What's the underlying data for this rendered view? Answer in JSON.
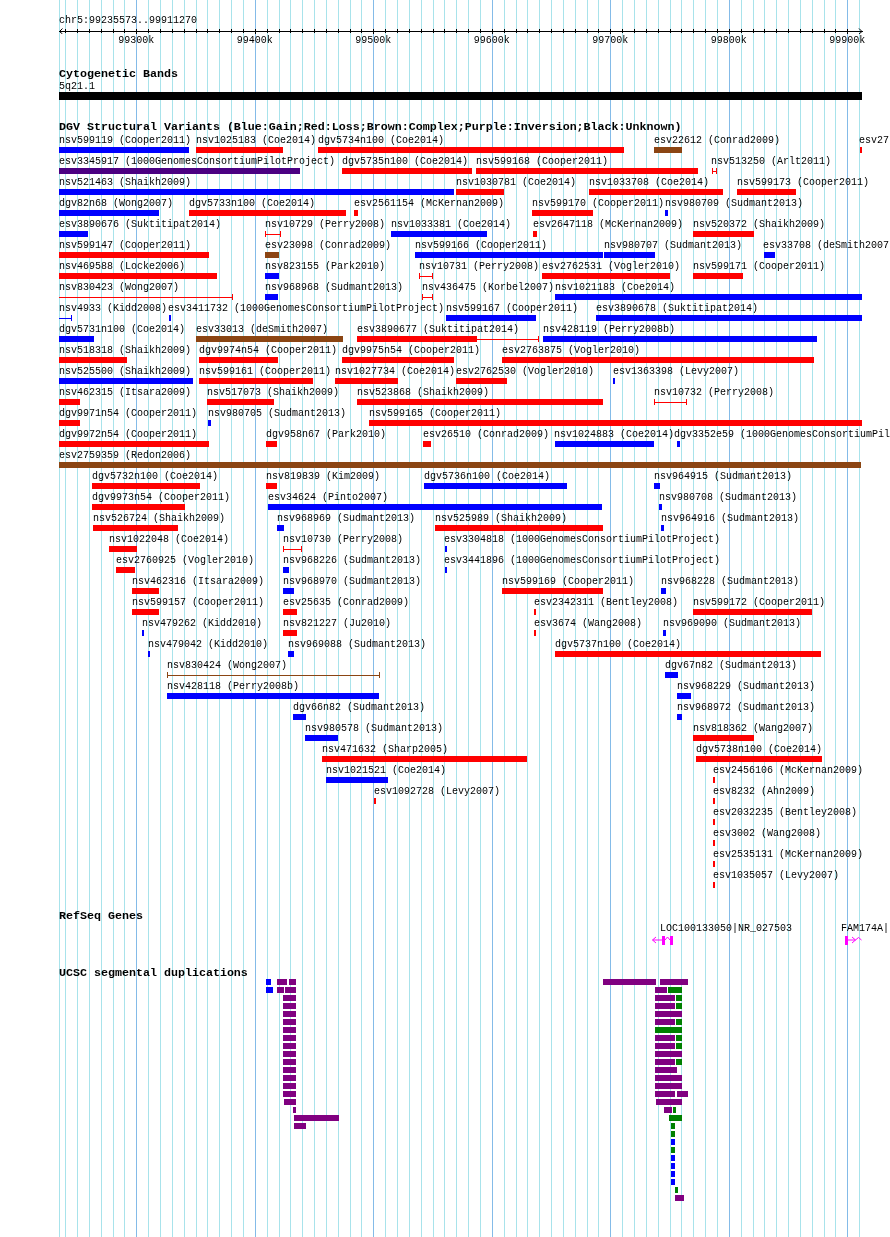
{
  "ruler": {
    "title": "chr5:99235573..99911270",
    "ticks": [
      "99300k",
      "99400k",
      "99500k",
      "99600k",
      "99700k",
      "99800k",
      "99900k"
    ]
  },
  "cytogenetic_bands": {
    "title": "Cytogenetic Bands",
    "bands": [
      {
        "label": "5q21.1"
      }
    ]
  },
  "dgv_variants": {
    "title": "DGV Structural Variants (Blue:Gain;Red:Loss;Brown:Complex;Purple:Inversion;Black:Unknown)",
    "features": [
      {
        "label": "nsv599119 (Cooper2011)",
        "color": "#0000ff",
        "kind": "bar"
      },
      {
        "label": "nsv1025183 (Coe2014)",
        "color": "#ff0000",
        "kind": "bar"
      },
      {
        "label": "dgv5734n100 (Coe2014)",
        "color": "#ff0000",
        "kind": "bar"
      },
      {
        "label": "esv22612 (Conrad2009)",
        "color": "#8b4513",
        "kind": "bar"
      },
      {
        "label": "esv27",
        "color": "#ff0000",
        "kind": "bar"
      },
      {
        "label": "esv3345917 (1000GenomesConsortiumPilotProject)",
        "color": "#4b0082",
        "kind": "bar"
      },
      {
        "label": "dgv5735n100 (Coe2014)",
        "color": "#ff0000",
        "kind": "bar"
      },
      {
        "label": "nsv599168 (Cooper2011)",
        "color": "#ff0000",
        "kind": "bar"
      },
      {
        "label": "nsv513250 (Arlt2011)",
        "color": "#ff0000",
        "kind": "interval"
      },
      {
        "label": "nsv521463 (Shaikh2009)",
        "color": "#0000ff",
        "kind": "bar"
      },
      {
        "label": "nsv1030781 (Coe2014)",
        "color": "#ff0000",
        "kind": "bar"
      },
      {
        "label": "nsv1033708 (Coe2014)",
        "color": "#ff0000",
        "kind": "bar"
      },
      {
        "label": "nsv599173 (Cooper2011)",
        "color": "#ff0000",
        "kind": "bar"
      },
      {
        "label": "dgv82n68 (Wong2007)",
        "color": "#0000ff",
        "kind": "bar"
      },
      {
        "label": "dgv5733n100 (Coe2014)",
        "color": "#ff0000",
        "kind": "bar"
      },
      {
        "label": "esv2561154 (McKernan2009)",
        "color": "#ff0000",
        "kind": "bar"
      },
      {
        "label": "nsv599170 (Cooper2011)",
        "color": "#ff0000",
        "kind": "bar"
      },
      {
        "label": "nsv980709 (Sudmant2013)",
        "color": "#0000ff",
        "kind": "bar"
      },
      {
        "label": "esv3890676 (Suktitipat2014)",
        "color": "#0000ff",
        "kind": "bar"
      },
      {
        "label": "nsv10729 (Perry2008)",
        "color": "#ff0000",
        "kind": "interval"
      },
      {
        "label": "nsv1033381 (Coe2014)",
        "color": "#0000ff",
        "kind": "bar"
      },
      {
        "label": "esv2647118 (McKernan2009)",
        "color": "#ff0000",
        "kind": "bar"
      },
      {
        "label": "nsv520372 (Shaikh2009)",
        "color": "#ff0000",
        "kind": "bar"
      },
      {
        "label": "nsv599147 (Cooper2011)",
        "color": "#ff0000",
        "kind": "bar"
      },
      {
        "label": "esv23098 (Conrad2009)",
        "color": "#8b4513",
        "kind": "bar"
      },
      {
        "label": "nsv599166 (Cooper2011)",
        "color": "#0000ff",
        "kind": "bar"
      },
      {
        "label": "nsv980707 (Sudmant2013)",
        "color": "#0000ff",
        "kind": "bar"
      },
      {
        "label": "esv33708 (deSmith2007",
        "color": "#0000ff",
        "kind": "bar"
      },
      {
        "label": "nsv469588 (Locke2006)",
        "color": "#ff0000",
        "kind": "bar"
      },
      {
        "label": "nsv823155 (Park2010)",
        "color": "#0000ff",
        "kind": "bar"
      },
      {
        "label": "nsv10731 (Perry2008)",
        "color": "#ff0000",
        "kind": "interval"
      },
      {
        "label": "esv2762531 (Vogler2010)",
        "color": "#ff0000",
        "kind": "bar"
      },
      {
        "label": "nsv599171 (Cooper2011)",
        "color": "#ff0000",
        "kind": "bar"
      },
      {
        "label": "nsv830423 (Wong2007)",
        "color": "#ff0000",
        "kind": "interval"
      },
      {
        "label": "nsv968968 (Sudmant2013)",
        "color": "#0000ff",
        "kind": "bar"
      },
      {
        "label": "nsv436475 (Korbel2007)",
        "color": "#ff0000",
        "kind": "interval"
      },
      {
        "label": "nsv1021183 (Coe2014)",
        "color": "#0000ff",
        "kind": "bar"
      },
      {
        "label": "nsv4933 (Kidd2008)",
        "color": "#0000ff",
        "kind": "interval"
      },
      {
        "label": "esv3411732 (1000GenomesConsortiumPilotProject)",
        "color": "#0000ff",
        "kind": "bar"
      },
      {
        "label": "nsv599167 (Cooper2011)",
        "color": "#0000ff",
        "kind": "bar"
      },
      {
        "label": "esv3890678 (Suktitipat2014)",
        "color": "#0000ff",
        "kind": "bar"
      },
      {
        "label": "dgv5731n100 (Coe2014)",
        "color": "#0000ff",
        "kind": "bar"
      },
      {
        "label": "esv33013 (deSmith2007)",
        "color": "#8b4513",
        "kind": "bar"
      },
      {
        "label": "esv3890677 (Suktitipat2014)",
        "color": "#ff0000",
        "kind": "bar_interval"
      },
      {
        "label": "nsv428119 (Perry2008b)",
        "color": "#0000ff",
        "kind": "bar"
      },
      {
        "label": "nsv518318 (Shaikh2009)",
        "color": "#ff0000",
        "kind": "bar"
      },
      {
        "label": "dgv9974n54 (Cooper2011)",
        "color": "#ff0000",
        "kind": "bar"
      },
      {
        "label": "dgv9975n54 (Cooper2011)",
        "color": "#ff0000",
        "kind": "bar"
      },
      {
        "label": "esv2763875 (Vogler2010)",
        "color": "#ff0000",
        "kind": "bar"
      },
      {
        "label": "nsv525500 (Shaikh2009)",
        "color": "#0000ff",
        "kind": "bar"
      },
      {
        "label": "nsv599161 (Cooper2011)",
        "color": "#ff0000",
        "kind": "bar"
      },
      {
        "label": "nsv1027734 (Coe2014)",
        "color": "#ff0000",
        "kind": "bar"
      },
      {
        "label": "esv2762530 (Vogler2010)",
        "color": "#ff0000",
        "kind": "bar"
      },
      {
        "label": "esv1363398 (Levy2007)",
        "color": "#0000ff",
        "kind": "bar"
      },
      {
        "label": "nsv462315 (Itsara2009)",
        "color": "#ff0000",
        "kind": "bar"
      },
      {
        "label": "nsv517073 (Shaikh2009)",
        "color": "#ff0000",
        "kind": "bar"
      },
      {
        "label": "nsv523868 (Shaikh2009)",
        "color": "#ff0000",
        "kind": "bar"
      },
      {
        "label": "nsv10732 (Perry2008)",
        "color": "#ff0000",
        "kind": "interval"
      },
      {
        "label": "dgv9971n54 (Cooper2011)",
        "color": "#ff0000",
        "kind": "bar"
      },
      {
        "label": "nsv980705 (Sudmant2013)",
        "color": "#0000ff",
        "kind": "bar"
      },
      {
        "label": "nsv599165 (Cooper2011)",
        "color": "#ff0000",
        "kind": "bar"
      },
      {
        "label": "dgv9972n54 (Cooper2011)",
        "color": "#ff0000",
        "kind": "bar"
      },
      {
        "label": "dgv958n67 (Park2010)",
        "color": "#ff0000",
        "kind": "bar"
      },
      {
        "label": "esv26510 (Conrad2009)",
        "color": "#ff0000",
        "kind": "bar"
      },
      {
        "label": "nsv1024883 (Coe2014)",
        "color": "#0000ff",
        "kind": "bar"
      },
      {
        "label": "dgv3352e59 (1000GenomesConsortiumPil",
        "color": "#0000ff",
        "kind": "bar"
      },
      {
        "label": "esv2759359 (Redon2006)",
        "color": "#8b4513",
        "kind": "bar"
      },
      {
        "label": "dgv5732n100 (Coe2014)",
        "color": "#ff0000",
        "kind": "bar"
      },
      {
        "label": "nsv819839 (Kim2009)",
        "color": "#ff0000",
        "kind": "bar"
      },
      {
        "label": "dgv5736n100 (Coe2014)",
        "color": "#0000ff",
        "kind": "bar"
      },
      {
        "label": "nsv964915 (Sudmant2013)",
        "color": "#0000ff",
        "kind": "bar"
      },
      {
        "label": "dgv9973n54 (Cooper2011)",
        "color": "#ff0000",
        "kind": "bar"
      },
      {
        "label": "esv34624 (Pinto2007)",
        "color": "#0000ff",
        "kind": "bar"
      },
      {
        "label": "nsv980708 (Sudmant2013)",
        "color": "#0000ff",
        "kind": "bar"
      },
      {
        "label": "nsv526724 (Shaikh2009)",
        "color": "#ff0000",
        "kind": "bar"
      },
      {
        "label": "nsv968969 (Sudmant2013)",
        "color": "#0000ff",
        "kind": "bar"
      },
      {
        "label": "nsv525989 (Shaikh2009)",
        "color": "#ff0000",
        "kind": "bar"
      },
      {
        "label": "nsv964916 (Sudmant2013)",
        "color": "#0000ff",
        "kind": "bar"
      },
      {
        "label": "nsv1022048 (Coe2014)",
        "color": "#ff0000",
        "kind": "bar"
      },
      {
        "label": "nsv10730 (Perry2008)",
        "color": "#ff0000",
        "kind": "interval"
      },
      {
        "label": "esv3304818 (1000GenomesConsortiumPilotProject)",
        "color": "#0000ff",
        "kind": "bar"
      },
      {
        "label": "esv2760925 (Vogler2010)",
        "color": "#ff0000",
        "kind": "bar"
      },
      {
        "label": "nsv968226 (Sudmant2013)",
        "color": "#0000ff",
        "kind": "bar"
      },
      {
        "label": "esv3441896 (1000GenomesConsortiumPilotProject)",
        "color": "#0000ff",
        "kind": "bar"
      },
      {
        "label": "nsv462316 (Itsara2009)",
        "color": "#ff0000",
        "kind": "bar"
      },
      {
        "label": "nsv968970 (Sudmant2013)",
        "color": "#0000ff",
        "kind": "bar"
      },
      {
        "label": "nsv599169 (Cooper2011)",
        "color": "#ff0000",
        "kind": "bar"
      },
      {
        "label": "nsv968228 (Sudmant2013)",
        "color": "#0000ff",
        "kind": "bar"
      },
      {
        "label": "nsv599157 (Cooper2011)",
        "color": "#ff0000",
        "kind": "bar"
      },
      {
        "label": "esv25635 (Conrad2009)",
        "color": "#ff0000",
        "kind": "bar"
      },
      {
        "label": "esv2342311 (Bentley2008)",
        "color": "#ff0000",
        "kind": "bar"
      },
      {
        "label": "nsv599172 (Cooper2011)",
        "color": "#ff0000",
        "kind": "bar"
      },
      {
        "label": "nsv479262 (Kidd2010)",
        "color": "#0000ff",
        "kind": "bar"
      },
      {
        "label": "nsv821227 (Ju2010)",
        "color": "#ff0000",
        "kind": "bar"
      },
      {
        "label": "esv3674 (Wang2008)",
        "color": "#ff0000",
        "kind": "bar"
      },
      {
        "label": "nsv969090 (Sudmant2013)",
        "color": "#0000ff",
        "kind": "bar"
      },
      {
        "label": "nsv479042 (Kidd2010)",
        "color": "#0000ff",
        "kind": "bar"
      },
      {
        "label": "nsv969088 (Sudmant2013)",
        "color": "#0000ff",
        "kind": "bar"
      },
      {
        "label": "dgv5737n100 (Coe2014)",
        "color": "#ff0000",
        "kind": "bar"
      },
      {
        "label": "nsv830424 (Wong2007)",
        "color": "#8b4513",
        "kind": "interval"
      },
      {
        "label": "dgv67n82 (Sudmant2013)",
        "color": "#0000ff",
        "kind": "bar"
      },
      {
        "label": "nsv428118 (Perry2008b)",
        "color": "#0000ff",
        "kind": "bar"
      },
      {
        "label": "nsv968229 (Sudmant2013)",
        "color": "#0000ff",
        "kind": "bar"
      },
      {
        "label": "dgv66n82 (Sudmant2013)",
        "color": "#0000ff",
        "kind": "bar"
      },
      {
        "label": "nsv968972 (Sudmant2013)",
        "color": "#0000ff",
        "kind": "bar"
      },
      {
        "label": "nsv980578 (Sudmant2013)",
        "color": "#0000ff",
        "kind": "bar"
      },
      {
        "label": "nsv818362 (Wang2007)",
        "color": "#ff0000",
        "kind": "bar"
      },
      {
        "label": "nsv471632 (Sharp2005)",
        "color": "#ff0000",
        "kind": "bar"
      },
      {
        "label": "dgv5738n100 (Coe2014)",
        "color": "#ff0000",
        "kind": "bar"
      },
      {
        "label": "nsv1021521 (Coe2014)",
        "color": "#0000ff",
        "kind": "bar"
      },
      {
        "label": "esv2456106 (McKernan2009)",
        "color": "#ff0000",
        "kind": "bar"
      },
      {
        "label": "esv1092728 (Levy2007)",
        "color": "#ff0000",
        "kind": "bar"
      },
      {
        "label": "esv8232 (Ahn2009)",
        "color": "#ff0000",
        "kind": "bar"
      },
      {
        "label": "esv2032235 (Bentley2008)",
        "color": "#ff0000",
        "kind": "bar"
      },
      {
        "label": "esv3002 (Wang2008)",
        "color": "#ff0000",
        "kind": "bar"
      },
      {
        "label": "esv2535131 (McKernan2009)",
        "color": "#ff0000",
        "kind": "bar"
      },
      {
        "label": "esv1035057 (Levy2007)",
        "color": "#ff0000",
        "kind": "bar"
      }
    ]
  },
  "refseq_genes": {
    "title": "RefSeq Genes",
    "genes": [
      {
        "label": "LOC100133050|NR_027503",
        "minus_strand": true
      },
      {
        "label": "FAM174A|",
        "minus_strand": false
      }
    ]
  },
  "segmental_duplications": {
    "title": "UCSC segmental duplications",
    "blocks": [
      {
        "color": "#0000ff"
      },
      {
        "color": "#800080"
      },
      {
        "color": "#800080"
      },
      {
        "color": "#0000ff"
      },
      {
        "color": "#800080"
      },
      {
        "color": "#800080"
      },
      {
        "color": "#800080"
      },
      {
        "color": "#800080"
      },
      {
        "color": "#800080"
      },
      {
        "color": "#800080"
      },
      {
        "color": "#800080"
      },
      {
        "color": "#800080"
      },
      {
        "color": "#800080"
      },
      {
        "color": "#800080"
      },
      {
        "color": "#800080"
      },
      {
        "color": "#800080"
      },
      {
        "color": "#800080"
      },
      {
        "color": "#800080"
      },
      {
        "color": "#800080"
      },
      {
        "color": "#800080"
      },
      {
        "color": "#800080"
      },
      {
        "color": "#800080"
      },
      {
        "color": "#800080"
      },
      {
        "color": "#800080"
      },
      {
        "color": "#800080"
      },
      {
        "color": "#800080"
      },
      {
        "color": "#008000"
      },
      {
        "color": "#800080"
      },
      {
        "color": "#008000"
      },
      {
        "color": "#800080"
      },
      {
        "color": "#008000"
      },
      {
        "color": "#800080"
      },
      {
        "color": "#800080"
      },
      {
        "color": "#008000"
      },
      {
        "color": "#008000"
      },
      {
        "color": "#800080"
      },
      {
        "color": "#008000"
      },
      {
        "color": "#800080"
      },
      {
        "color": "#008000"
      },
      {
        "color": "#800080"
      },
      {
        "color": "#800080"
      },
      {
        "color": "#008000"
      },
      {
        "color": "#800080"
      },
      {
        "color": "#800080"
      },
      {
        "color": "#800080"
      },
      {
        "color": "#800080"
      },
      {
        "color": "#800080"
      },
      {
        "color": "#800080"
      },
      {
        "color": "#800080"
      },
      {
        "color": "#008000"
      },
      {
        "color": "#008000"
      },
      {
        "color": "#008000"
      },
      {
        "color": "#008000"
      },
      {
        "color": "#0000ff"
      },
      {
        "color": "#008000"
      },
      {
        "color": "#0000ff"
      },
      {
        "color": "#0000ff"
      },
      {
        "color": "#0000ff"
      },
      {
        "color": "#0000ff"
      },
      {
        "color": "#008000"
      },
      {
        "color": "#800080"
      }
    ]
  }
}
